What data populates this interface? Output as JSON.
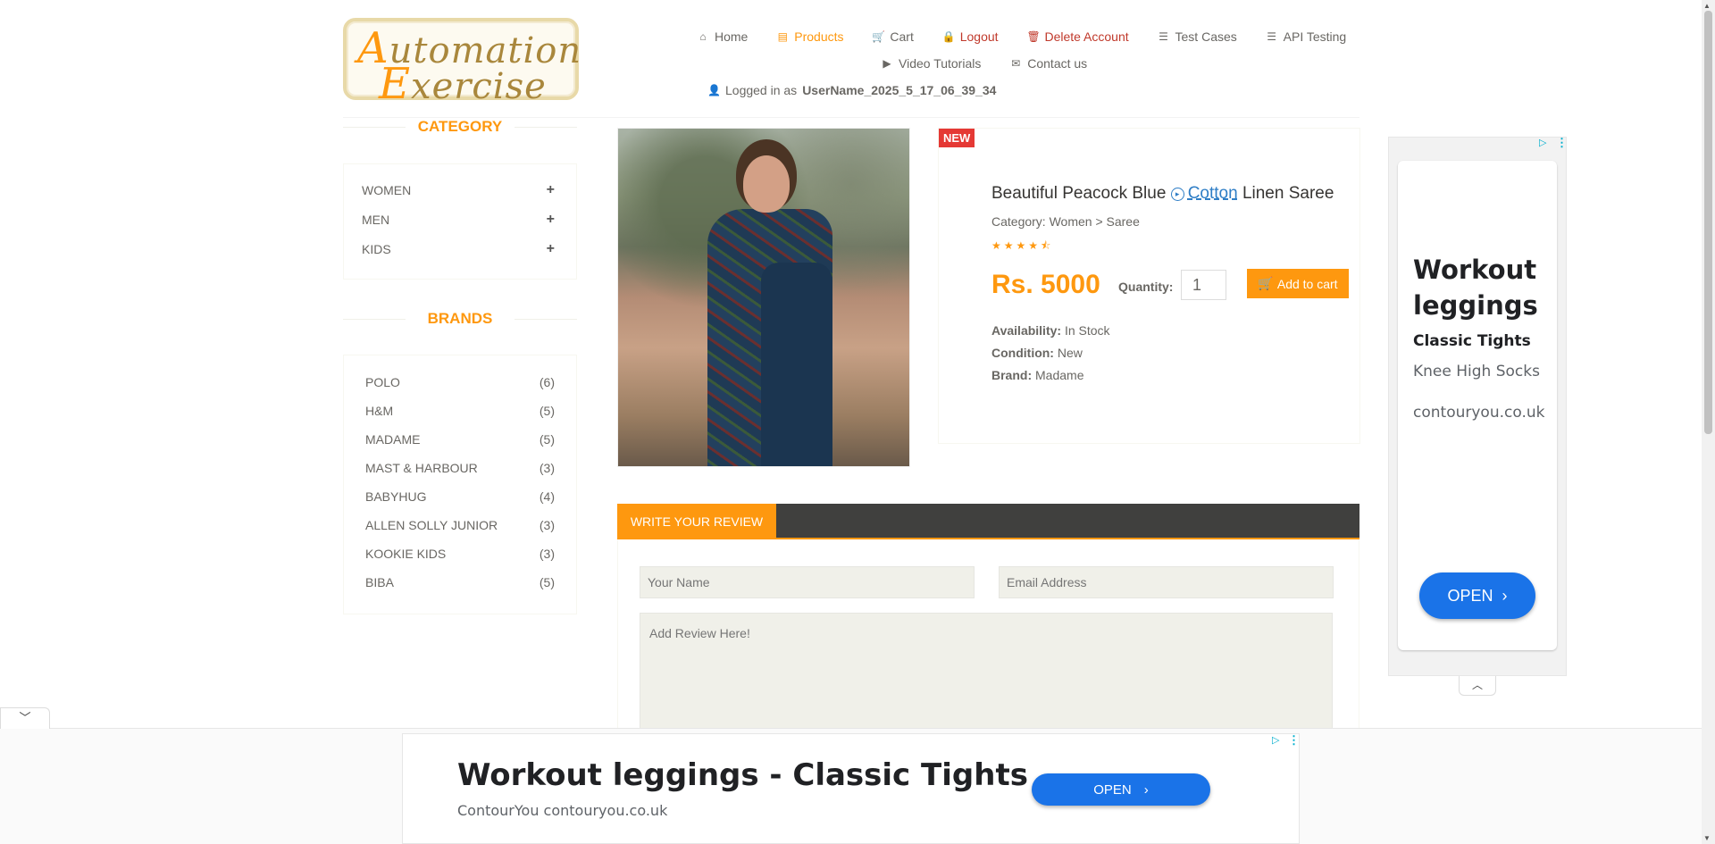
{
  "logo": {
    "alt": "Automation Exercise",
    "line1_cap": "A",
    "line1_rest": "utomation",
    "line2_cap": "E",
    "line2_rest": "xercise"
  },
  "nav": {
    "items": [
      {
        "label": "Home",
        "icon": "home-icon"
      },
      {
        "label": "Products",
        "icon": "products-icon"
      },
      {
        "label": "Cart",
        "icon": "cart-icon"
      },
      {
        "label": "Logout",
        "icon": "lock-icon"
      },
      {
        "label": "Delete Account",
        "icon": "trash-icon"
      },
      {
        "label": "Test Cases",
        "icon": "list-icon"
      },
      {
        "label": "API Testing",
        "icon": "list-icon"
      },
      {
        "label": "Video Tutorials",
        "icon": "youtube-icon"
      },
      {
        "label": "Contact us",
        "icon": "envelope-icon"
      }
    ],
    "logged_in_prefix": "Logged in as",
    "username": "UserName_2025_5_17_06_39_34",
    "active_color": "#fe980f"
  },
  "sidebar": {
    "category_title": "CATEGORY",
    "categories": [
      "WOMEN",
      "MEN",
      "KIDS"
    ],
    "brands_title": "BRANDS",
    "brands": [
      {
        "name": "POLO",
        "count": "(6)"
      },
      {
        "name": "H&M",
        "count": "(5)"
      },
      {
        "name": "MADAME",
        "count": "(5)"
      },
      {
        "name": "MAST & HARBOUR",
        "count": "(3)"
      },
      {
        "name": "BABYHUG",
        "count": "(4)"
      },
      {
        "name": "ALLEN SOLLY JUNIOR",
        "count": "(3)"
      },
      {
        "name": "KOOKIE KIDS",
        "count": "(3)"
      },
      {
        "name": "BIBA",
        "count": "(5)"
      }
    ]
  },
  "product": {
    "badge": "NEW",
    "title_start": "Beautiful Peacock Blue",
    "title_link": "Cotton",
    "title_end": "Linen Saree",
    "category": "Category: Women > Saree",
    "rating": 4.5,
    "price": "Rs. 5000",
    "quantity_label": "Quantity:",
    "quantity_value": "1",
    "add_to_cart": "Add to cart",
    "availability_label": "Availability:",
    "availability": "In Stock",
    "condition_label": "Condition:",
    "condition": "New",
    "brand_label": "Brand:",
    "brand": "Madame"
  },
  "review": {
    "tab": "WRITE YOUR REVIEW",
    "name_placeholder": "Your Name",
    "email_placeholder": "Email Address",
    "review_placeholder": "Add Review Here!"
  },
  "side_ad": {
    "headline": "Workout leggings",
    "subtitle": "Classic Tights",
    "line1": "Knee High Socks",
    "domain": "contouryou.co.uk",
    "button": "OPEN"
  },
  "bottom_ad": {
    "headline": "Workout leggings - Classic Tights",
    "subtitle": "ContourYou contouryou.co.uk",
    "button": "OPEN"
  }
}
